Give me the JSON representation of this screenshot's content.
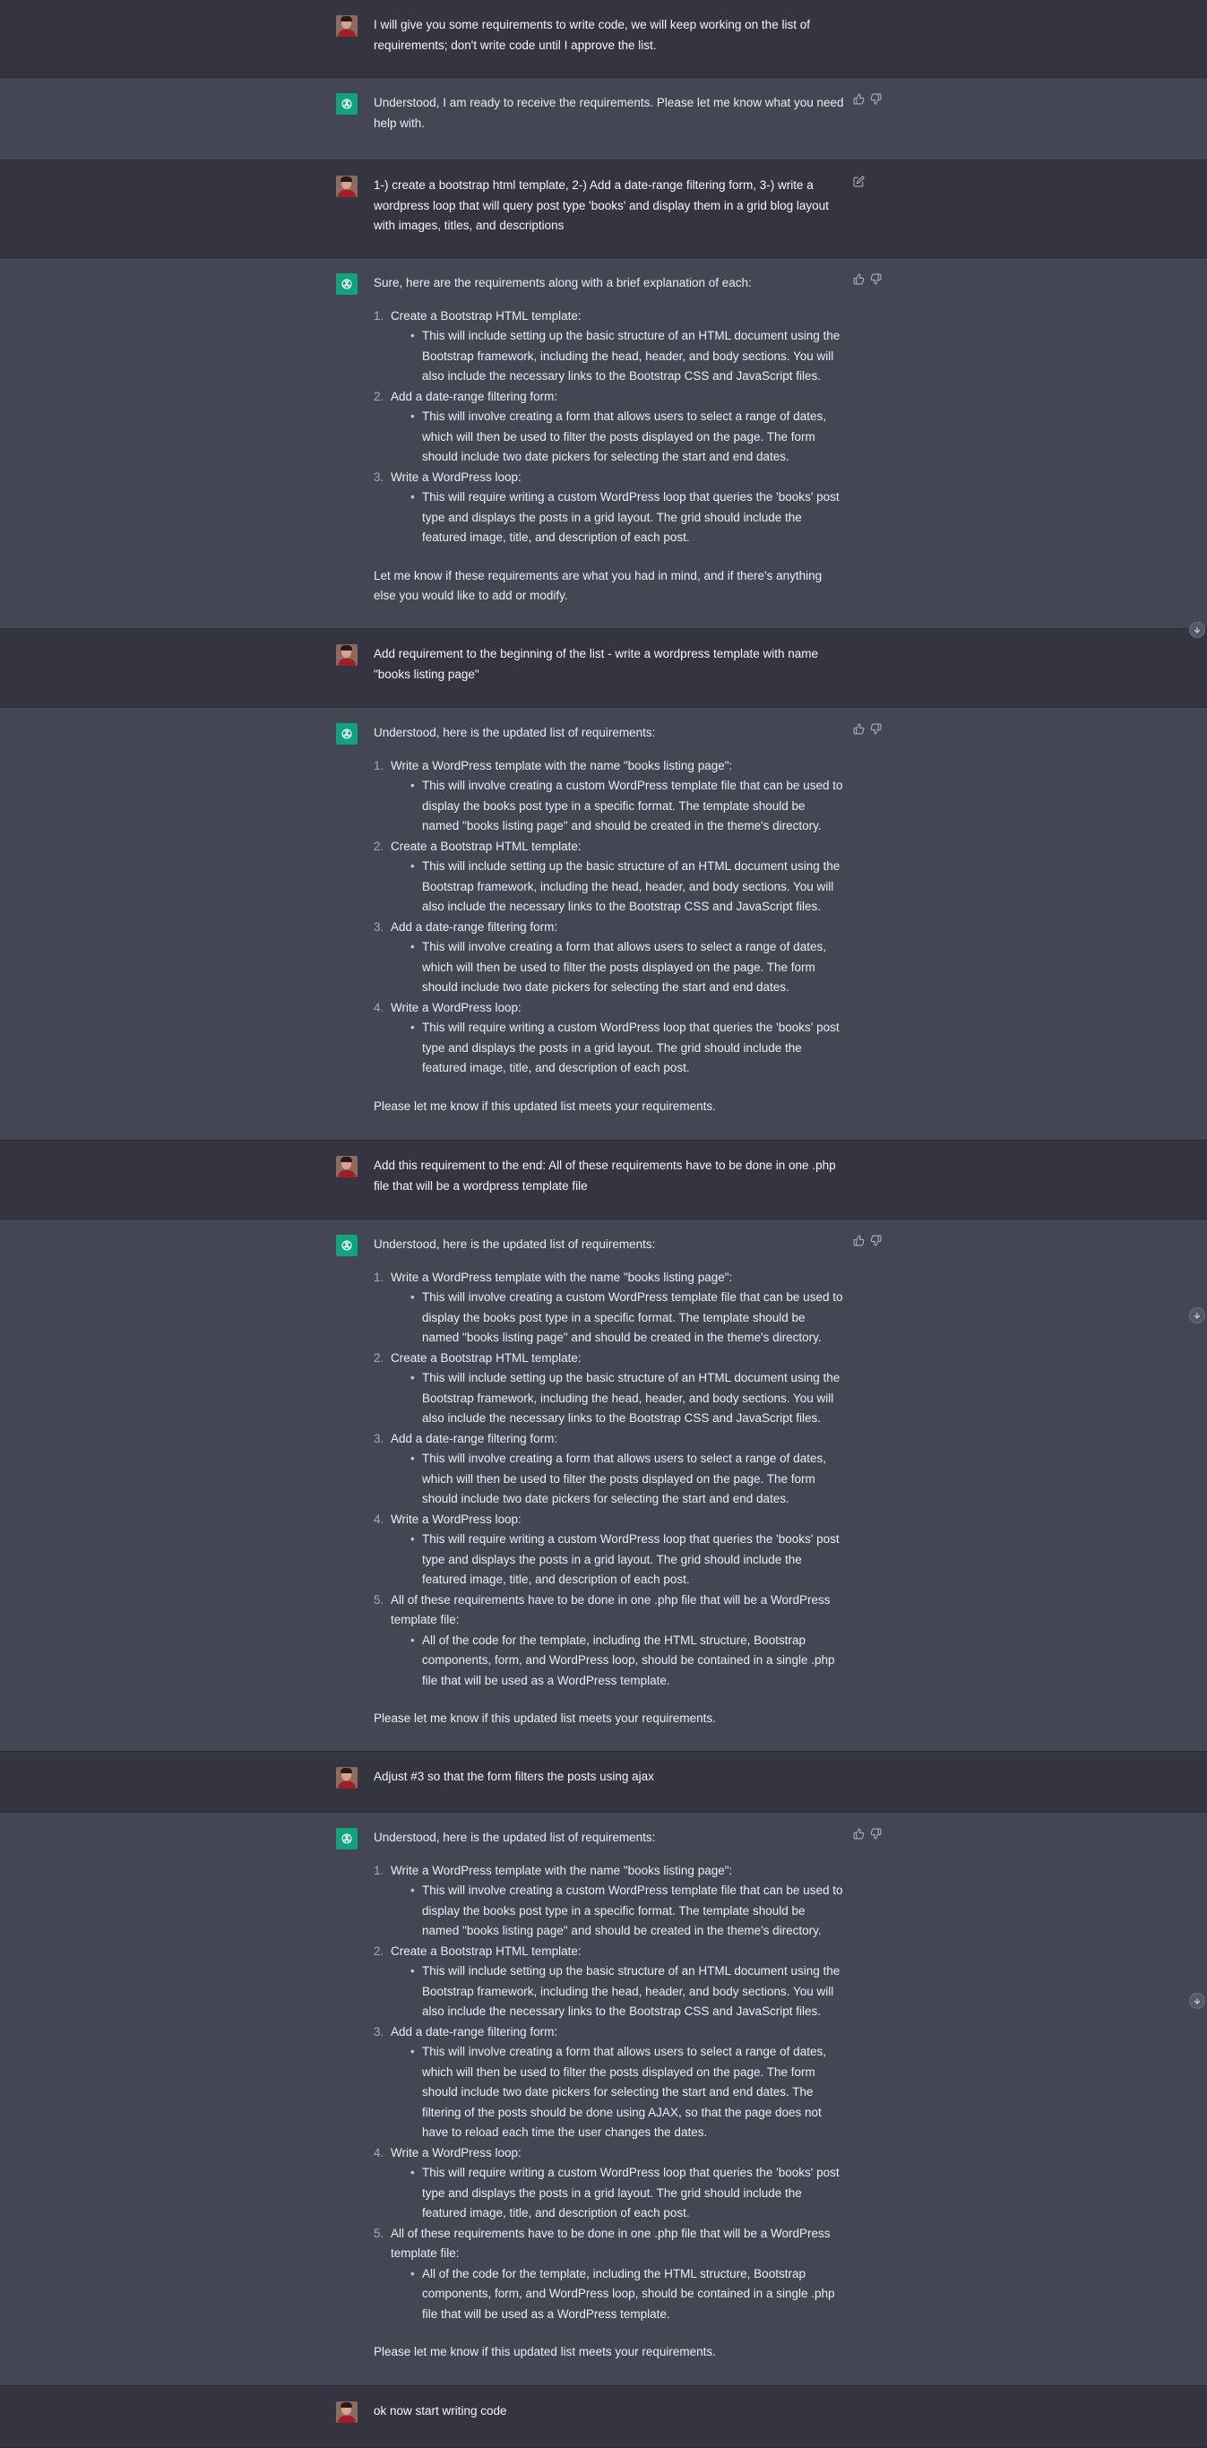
{
  "messages": [
    {
      "role": "user",
      "text": "I will give you some requirements to write code, we will keep working on the list of requirements; don't write code until I approve the list."
    },
    {
      "role": "assistant",
      "intro": "Understood, I am ready to receive the requirements. Please let me know what you need help with."
    },
    {
      "role": "user",
      "text": "1-) create a bootstrap html template, 2-) Add a date-range filtering form, 3-) write a wordpress loop that will query post type 'books' and display them in a grid blog layout with images, titles, and descriptions"
    },
    {
      "role": "assistant",
      "intro": "Sure, here are the requirements along with a brief explanation of each:",
      "items": [
        {
          "num": "1.",
          "title": "Create a Bootstrap HTML template:",
          "detail": "This will include setting up the basic structure of an HTML document using the Bootstrap framework, including the head, header, and body sections. You will also include the necessary links to the Bootstrap CSS and JavaScript files."
        },
        {
          "num": "2.",
          "title": "Add a date-range filtering form:",
          "detail": "This will involve creating a form that allows users to select a range of dates, which will then be used to filter the posts displayed on the page. The form should include two date pickers for selecting the start and end dates."
        },
        {
          "num": "3.",
          "title": "Write a WordPress loop:",
          "detail": "This will require writing a custom WordPress loop that queries the 'books' post type and displays the posts in a grid layout. The grid should include the featured image, title, and description of each post."
        }
      ],
      "outro": "Let me know if these requirements are what you had in mind, and if there's anything else you would like to add or modify."
    },
    {
      "role": "user",
      "text": "Add requirement to the beginning of the list - write a wordpress template with name \"books listing page\""
    },
    {
      "role": "assistant",
      "intro": "Understood, here is the updated list of requirements:",
      "items": [
        {
          "num": "1.",
          "title": "Write a WordPress template with the name \"books listing page\":",
          "detail": "This will involve creating a custom WordPress template file that can be used to display the books post type in a specific format. The template should be named \"books listing page\" and should be created in the theme's directory."
        },
        {
          "num": "2.",
          "title": "Create a Bootstrap HTML template:",
          "detail": "This will include setting up the basic structure of an HTML document using the Bootstrap framework, including the head, header, and body sections. You will also include the necessary links to the Bootstrap CSS and JavaScript files."
        },
        {
          "num": "3.",
          "title": "Add a date-range filtering form:",
          "detail": "This will involve creating a form that allows users to select a range of dates, which will then be used to filter the posts displayed on the page. The form should include two date pickers for selecting the start and end dates."
        },
        {
          "num": "4.",
          "title": "Write a WordPress loop:",
          "detail": "This will require writing a custom WordPress loop that queries the 'books' post type and displays the posts in a grid layout. The grid should include the featured image, title, and description of each post."
        }
      ],
      "outro": "Please let me know if this updated list meets your requirements."
    },
    {
      "role": "user",
      "text": "Add this requirement to the end: All of these requirements have to be done in one .php file that will be a wordpress template file"
    },
    {
      "role": "assistant",
      "intro": "Understood, here is the updated list of requirements:",
      "items": [
        {
          "num": "1.",
          "title": "Write a WordPress template with the name \"books listing page\":",
          "detail": "This will involve creating a custom WordPress template file that can be used to display the books post type in a specific format. The template should be named \"books listing page\" and should be created in the theme's directory."
        },
        {
          "num": "2.",
          "title": "Create a Bootstrap HTML template:",
          "detail": "This will include setting up the basic structure of an HTML document using the Bootstrap framework, including the head, header, and body sections. You will also include the necessary links to the Bootstrap CSS and JavaScript files."
        },
        {
          "num": "3.",
          "title": "Add a date-range filtering form:",
          "detail": "This will involve creating a form that allows users to select a range of dates, which will then be used to filter the posts displayed on the page. The form should include two date pickers for selecting the start and end dates."
        },
        {
          "num": "4.",
          "title": "Write a WordPress loop:",
          "detail": "This will require writing a custom WordPress loop that queries the 'books' post type and displays the posts in a grid layout. The grid should include the featured image, title, and description of each post."
        },
        {
          "num": "5.",
          "title": "All of these requirements have to be done in one .php file that will be a WordPress template file:",
          "detail": "All of the code for the template, including the HTML structure, Bootstrap components, form, and WordPress loop, should be contained in a single .php file that will be used as a WordPress template."
        }
      ],
      "outro": "Please let me know if this updated list meets your requirements."
    },
    {
      "role": "user",
      "text": "Adjust #3 so that the form filters the posts using ajax"
    },
    {
      "role": "assistant",
      "intro": "Understood, here is the updated list of requirements:",
      "items": [
        {
          "num": "1.",
          "title": "Write a WordPress template with the name \"books listing page\":",
          "detail": "This will involve creating a custom WordPress template file that can be used to display the books post type in a specific format. The template should be named \"books listing page\" and should be created in the theme's directory."
        },
        {
          "num": "2.",
          "title": "Create a Bootstrap HTML template:",
          "detail": "This will include setting up the basic structure of an HTML document using the Bootstrap framework, including the head, header, and body sections. You will also include the necessary links to the Bootstrap CSS and JavaScript files."
        },
        {
          "num": "3.",
          "title": "Add a date-range filtering form:",
          "detail": "This will involve creating a form that allows users to select a range of dates, which will then be used to filter the posts displayed on the page. The form should include two date pickers for selecting the start and end dates. The filtering of the posts should be done using AJAX, so that the page does not have to reload each time the user changes the dates."
        },
        {
          "num": "4.",
          "title": "Write a WordPress loop:",
          "detail": "This will require writing a custom WordPress loop that queries the 'books' post type and displays the posts in a grid layout. The grid should include the featured image, title, and description of each post."
        },
        {
          "num": "5.",
          "title": "All of these requirements have to be done in one .php file that will be a WordPress template file:",
          "detail": "All of the code for the template, including the HTML structure, Bootstrap components, form, and WordPress loop, should be contained in a single .php file that will be used as a WordPress template."
        }
      ],
      "outro": "Please let me know if this updated list meets your requirements."
    },
    {
      "role": "user",
      "text": "ok now start writing code"
    }
  ],
  "icons": {
    "user_avatar": "user-avatar",
    "assistant_avatar": "openai-logo-icon",
    "edit": "edit-icon",
    "thumbs_up": "thumbs-up-icon",
    "thumbs_down": "thumbs-down-icon",
    "scroll_down": "arrow-down-icon"
  },
  "colors": {
    "user_bg": "#343541",
    "assistant_bg": "#444654",
    "brand": "#10a37f"
  }
}
